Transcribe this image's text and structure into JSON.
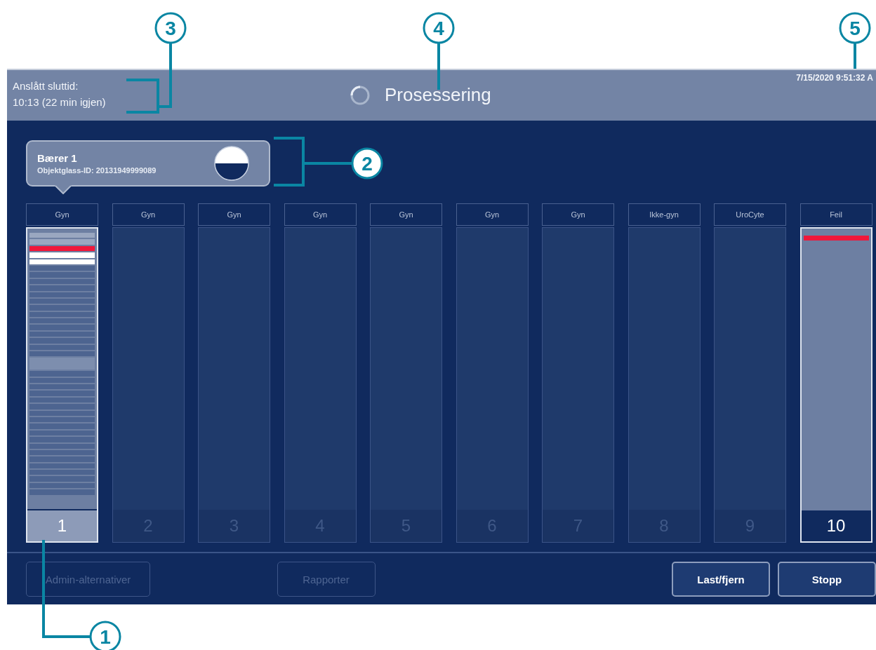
{
  "header": {
    "end_time_label": "Anslått sluttid:",
    "end_time_value": "10:13 (22 min igjen)",
    "title": "Prosessering",
    "timestamp": "7/15/2020 9:51:32 A"
  },
  "tooltip": {
    "title": "Bærer 1",
    "subtitle": "Objektglass-ID: 20131949999089"
  },
  "racks": [
    {
      "label": "Gyn",
      "number": "1",
      "kind": "active",
      "slots": [
        {
          "kind": "processed"
        },
        {
          "kind": "processed"
        },
        {
          "kind": "error"
        },
        {
          "kind": "loaded"
        },
        {
          "kind": "loaded"
        },
        {
          "kind": "pending"
        },
        {
          "kind": "pending"
        },
        {
          "kind": "pending"
        },
        {
          "kind": "pending"
        },
        {
          "kind": "pending"
        },
        {
          "kind": "pending"
        },
        {
          "kind": "pending"
        },
        {
          "kind": "pending"
        },
        {
          "kind": "pending"
        },
        {
          "kind": "pending"
        },
        {
          "kind": "pending"
        },
        {
          "kind": "pending"
        },
        {
          "kind": "pending"
        },
        {
          "kind": "pending"
        },
        {
          "kind": "vacant"
        },
        {
          "kind": "pending"
        },
        {
          "kind": "pending"
        },
        {
          "kind": "pending"
        },
        {
          "kind": "pending"
        },
        {
          "kind": "pending"
        },
        {
          "kind": "pending"
        },
        {
          "kind": "pending"
        },
        {
          "kind": "pending"
        },
        {
          "kind": "pending"
        },
        {
          "kind": "pending"
        },
        {
          "kind": "pending"
        },
        {
          "kind": "pending"
        },
        {
          "kind": "pending"
        },
        {
          "kind": "pending"
        },
        {
          "kind": "pending"
        },
        {
          "kind": "pending"
        },
        {
          "kind": "pending"
        },
        {
          "kind": "pending"
        },
        {
          "kind": "pending"
        }
      ]
    },
    {
      "label": "Gyn",
      "number": "2",
      "kind": "empty"
    },
    {
      "label": "Gyn",
      "number": "3",
      "kind": "empty"
    },
    {
      "label": "Gyn",
      "number": "4",
      "kind": "empty"
    },
    {
      "label": "Gyn",
      "number": "5",
      "kind": "empty"
    },
    {
      "label": "Gyn",
      "number": "6",
      "kind": "empty"
    },
    {
      "label": "Gyn",
      "number": "7",
      "kind": "empty"
    },
    {
      "label": "Ikke-gyn",
      "number": "8",
      "kind": "empty"
    },
    {
      "label": "UroCyte",
      "number": "9",
      "kind": "empty"
    },
    {
      "label": "Feil",
      "number": "10",
      "kind": "error",
      "slots": [
        {
          "kind": "error"
        }
      ]
    }
  ],
  "buttons": [
    {
      "label": "Admin-alternativer",
      "disabled": true
    },
    {
      "label": "Rapporter",
      "disabled": true
    },
    {
      "label": "Last/fjern",
      "disabled": false
    },
    {
      "label": "Stopp",
      "disabled": false
    }
  ],
  "callouts": [
    "1",
    "2",
    "3",
    "4",
    "5"
  ]
}
